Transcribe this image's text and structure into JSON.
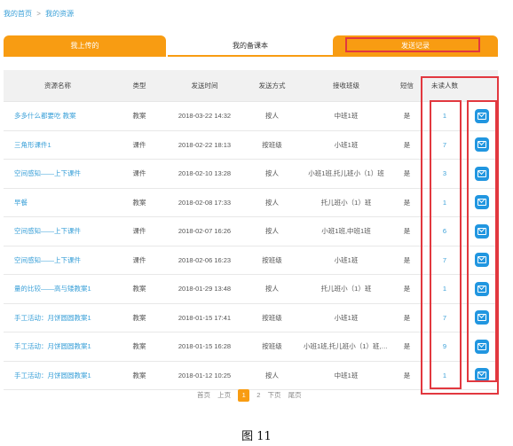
{
  "breadcrumb": {
    "home": "我的首页",
    "separator": ">",
    "current": "我的资源"
  },
  "tabs": {
    "uploaded": "我上传的",
    "lesson_plans": "我的备课本",
    "send_records": "发送记录"
  },
  "table": {
    "headers": [
      "资源名称",
      "类型",
      "发送时间",
      "发送方式",
      "接收班级",
      "短信",
      "未读人数",
      ""
    ],
    "rows": [
      {
        "name": "多多什么都要吃 教案",
        "type": "教案",
        "time": "2018-03-22 14:32",
        "method": "按人",
        "classes": "中班1班",
        "sms": "是",
        "unread": "1"
      },
      {
        "name": "三角形课件1",
        "type": "课件",
        "time": "2018-02-22 18:13",
        "method": "按班级",
        "classes": "小班1班",
        "sms": "是",
        "unread": "7"
      },
      {
        "name": "空间感知——上下课件",
        "type": "课件",
        "time": "2018-02-10 13:28",
        "method": "按人",
        "classes": "小班1班,托儿班小（1）班",
        "sms": "是",
        "unread": "3"
      },
      {
        "name": "早餐",
        "type": "教案",
        "time": "2018-02-08 17:33",
        "method": "按人",
        "classes": "托儿班小（1）班",
        "sms": "是",
        "unread": "1"
      },
      {
        "name": "空间感知——上下课件",
        "type": "课件",
        "time": "2018-02-07 16:26",
        "method": "按人",
        "classes": "小班1班,中班1班",
        "sms": "是",
        "unread": "6"
      },
      {
        "name": "空间感知——上下课件",
        "type": "课件",
        "time": "2018-02-06 16:23",
        "method": "按班级",
        "classes": "小班1班",
        "sms": "是",
        "unread": "7"
      },
      {
        "name": "量的比较——高与矮教案1",
        "type": "教案",
        "time": "2018-01-29 13:48",
        "method": "按人",
        "classes": "托儿班小（1）班",
        "sms": "是",
        "unread": "1"
      },
      {
        "name": "手工活动：月饼圆圆教案1",
        "type": "教案",
        "time": "2018-01-15 17:41",
        "method": "按班级",
        "classes": "小班1班",
        "sms": "是",
        "unread": "7"
      },
      {
        "name": "手工活动：月饼圆圆教案1",
        "type": "教案",
        "time": "2018-01-15 16:28",
        "method": "按班级",
        "classes": "小班1班,托儿班小（1）班,中...",
        "sms": "是",
        "unread": "9"
      },
      {
        "name": "手工活动：月饼圆圆教案1",
        "type": "教案",
        "time": "2018-01-12 10:25",
        "method": "按人",
        "classes": "中班1班",
        "sms": "是",
        "unread": "1"
      }
    ],
    "action_icon": "mail-icon"
  },
  "pagination": {
    "first": "首页",
    "prev": "上页",
    "current": "1",
    "page2": "2",
    "next": "下页",
    "last": "尾页"
  },
  "caption": "图 11",
  "colors": {
    "accent": "#f89c12",
    "link": "#3aa0d8",
    "highlight": "#e2383f",
    "action": "#2196e0"
  }
}
